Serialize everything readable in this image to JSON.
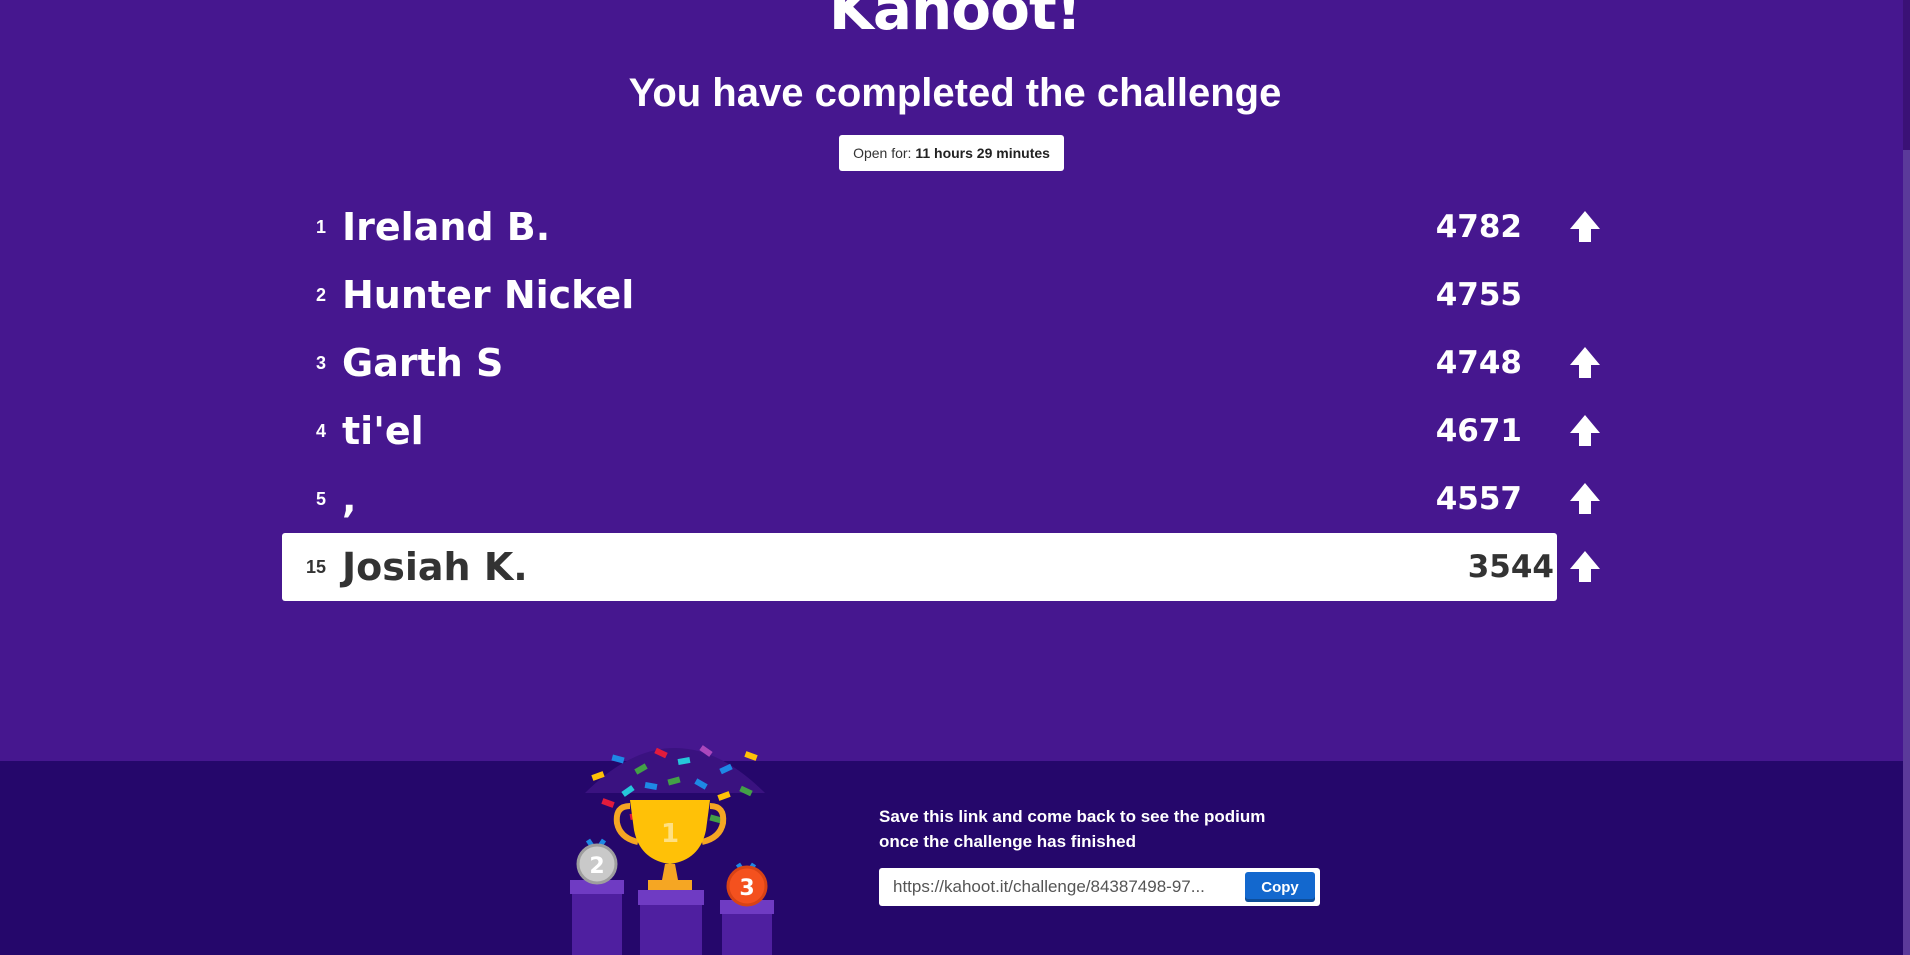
{
  "brand": {
    "logo_text": "Kahoot!"
  },
  "header": {
    "title": "You have completed the challenge",
    "open_for_label": "Open for:",
    "open_for_value": "11 hours 29 minutes"
  },
  "leaderboard": [
    {
      "rank": "1",
      "name": "Ireland B.",
      "score": "4782",
      "trend": "up"
    },
    {
      "rank": "2",
      "name": "Hunter Nickel",
      "score": "4755",
      "trend": "none"
    },
    {
      "rank": "3",
      "name": "Garth S",
      "score": "4748",
      "trend": "up"
    },
    {
      "rank": "4",
      "name": "ti'el",
      "score": "4671",
      "trend": "up"
    },
    {
      "rank": "5",
      "name": ",",
      "score": "4557",
      "trend": "up"
    }
  ],
  "current_player": {
    "rank": "15",
    "name": "Josiah K.",
    "score": "3544",
    "trend": "up"
  },
  "footer": {
    "save_text": "Save this link and come back to see the podium once the challenge has finished",
    "link_value": "https://kahoot.it/challenge/84387498-97...",
    "copy_label": "Copy",
    "podium_labels": [
      "1",
      "2",
      "3"
    ]
  },
  "colors": {
    "background": "#46178f",
    "footer": "#25076b",
    "copy_button": "#1368ce"
  }
}
